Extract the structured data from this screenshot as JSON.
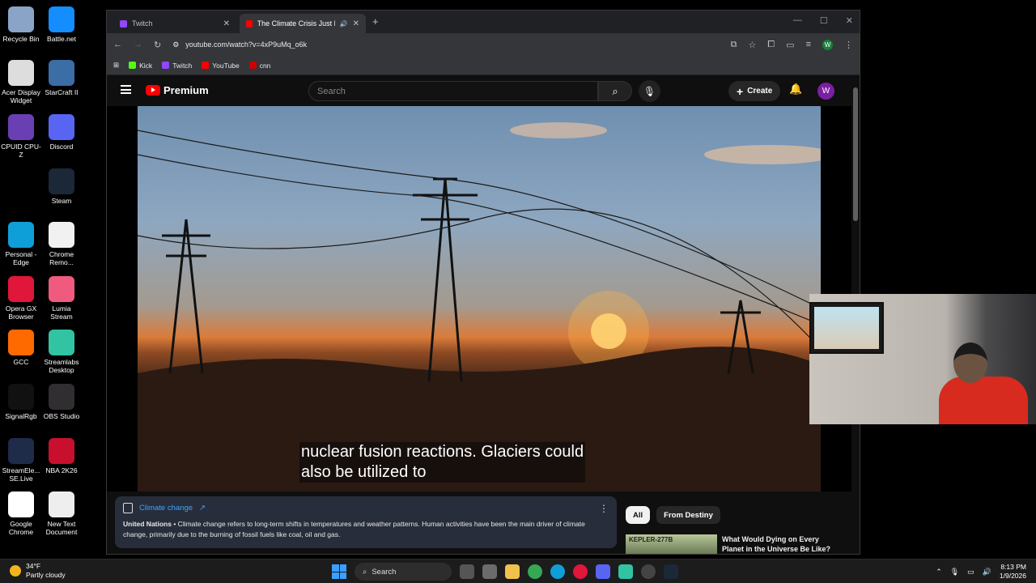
{
  "desktop": {
    "icons": [
      {
        "label": "Recycle Bin",
        "color": "#8aa4c8"
      },
      {
        "label": "Battle.net",
        "color": "#148eff"
      },
      {
        "label": "Acer Display Widget",
        "color": "#dddddd"
      },
      {
        "label": "StarCraft II",
        "color": "#3a6ea5"
      },
      {
        "label": "CPUID CPU-Z",
        "color": "#6a3fb4"
      },
      {
        "label": "Discord",
        "color": "#5865f2"
      },
      {
        "label": "Steam",
        "color": "#1b2838"
      },
      {
        "label": "Personal - Edge",
        "color": "#0f9fd8"
      },
      {
        "label": "Chrome Remo...",
        "color": "#f1f1f1"
      },
      {
        "label": "Opera GX Browser",
        "color": "#e0163b"
      },
      {
        "label": "Lumia Stream",
        "color": "#f05a7e"
      },
      {
        "label": "GCC",
        "color": "#ff6a00"
      },
      {
        "label": "Streamlabs Desktop",
        "color": "#31c3a2"
      },
      {
        "label": "SignalRgb",
        "color": "#111111"
      },
      {
        "label": "OBS Studio",
        "color": "#302e31"
      },
      {
        "label": "StreamEle... SE.Live",
        "color": "#1e2b49"
      },
      {
        "label": "NBA 2K26",
        "color": "#c8102e"
      },
      {
        "label": "Google Chrome",
        "color": "#ffffff"
      },
      {
        "label": "New Text Document",
        "color": "#eeeeee"
      }
    ]
  },
  "browser": {
    "tabs": [
      {
        "title": "Twitch",
        "favicon_color": "#9146ff",
        "active": false
      },
      {
        "title": "The Climate Crisis Just Hit a",
        "favicon_color": "#ff0000",
        "active": true
      }
    ],
    "new_tab": "+",
    "url": "youtube.com/watch?v=4xP9uMq_o6k",
    "profile_initial": "W",
    "bookmarks": [
      {
        "label": "Kick",
        "color": "#53fc18"
      },
      {
        "label": "Twitch",
        "color": "#9146ff"
      },
      {
        "label": "YouTube",
        "color": "#ff0000"
      },
      {
        "label": "cnn",
        "color": "#cc0000"
      }
    ]
  },
  "youtube": {
    "logo_text": "Premium",
    "search_placeholder": "Search",
    "create_label": "Create",
    "avatar_initial": "W",
    "caption_line1": "nuclear fusion reactions. Glaciers could",
    "caption_line2": "also be utilized to",
    "info_card": {
      "title": "Climate change",
      "source": "United Nations",
      "text": " • Climate change refers to long-term shifts in temperatures and weather patterns. Human activities have been the main driver of climate change, primarily due to the burning of fossil fuels like coal, oil and gas."
    },
    "chips": [
      "All",
      "From Destiny"
    ],
    "recommendation": {
      "thumb_text": "KEPLER-277B",
      "title": "What Would Dying on Every Planet in the Universe Be Like?"
    }
  },
  "taskbar": {
    "weather_temp": "34°F",
    "weather_desc": "Partly cloudy",
    "search_label": "Search",
    "time": "8:13 PM",
    "date": "1/9/2026"
  }
}
